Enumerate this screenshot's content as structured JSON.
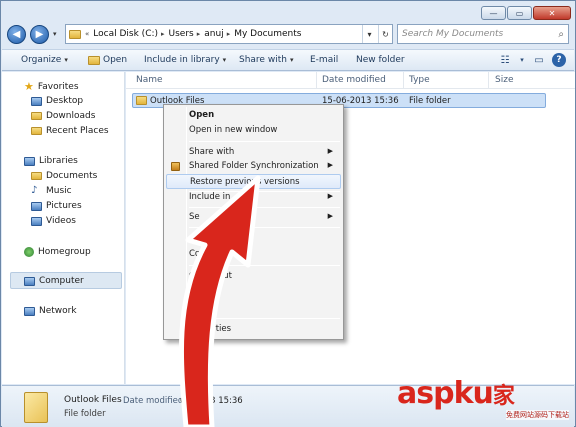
{
  "window": {
    "controls": {
      "minimize": "—",
      "maximize": "▭",
      "close": "✕"
    }
  },
  "address": {
    "chevron": "«",
    "crumbs": [
      "Local Disk (C:)",
      "Users",
      "anuj",
      "My Documents"
    ],
    "refresh": "↻",
    "search_placeholder": "Search My Documents"
  },
  "toolbar": {
    "organize": "Organize",
    "open": "Open",
    "include_in_library": "Include in library",
    "share_with": "Share with",
    "email": "E-mail",
    "new_folder": "New folder"
  },
  "navpane": {
    "favorites": "Favorites",
    "desktop": "Desktop",
    "downloads": "Downloads",
    "recent_places": "Recent Places",
    "libraries": "Libraries",
    "documents": "Documents",
    "music": "Music",
    "pictures": "Pictures",
    "videos": "Videos",
    "homegroup": "Homegroup",
    "computer": "Computer",
    "network": "Network"
  },
  "columns": {
    "name": "Name",
    "date_modified": "Date modified",
    "type": "Type",
    "size": "Size"
  },
  "file": {
    "name": "Outlook Files",
    "date": "15-06-2013 15:36",
    "type": "File folder"
  },
  "context_menu": {
    "open": "Open",
    "open_new_window": "Open in new window",
    "share_with": "Share with",
    "shared_folder_sync": "Shared Folder Synchronization",
    "restore_previous": "Restore previous versions",
    "include_in": "Include in",
    "send_frag": "Se",
    "cut_frag": "C",
    "copy_frag": "Co",
    "create_shortcut_frag": "Cr         hortcut",
    "delete_frag": "D",
    "rename_frag": "R         me",
    "properties_frag": "erties"
  },
  "details": {
    "name": "Outlook Files",
    "type": "File folder",
    "date_label": "Date modified:",
    "date_value": "  06-2013 15:36"
  },
  "watermark": {
    "main": "aspku",
    "accent": "家",
    "sub": "免费网站源码下载站"
  },
  "colors": {
    "selection": "#cce0f7",
    "arrow": "#d9261c",
    "toolbar_text": "#1e395b"
  }
}
